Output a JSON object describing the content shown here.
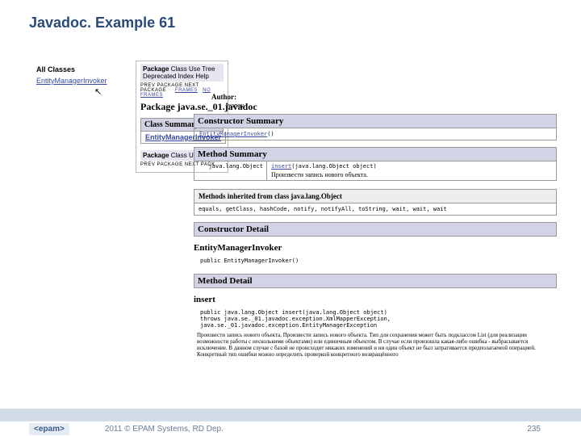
{
  "slide": {
    "title": "Javadoc. Example 61"
  },
  "left": {
    "all_classes": "All Classes",
    "class_link": "EntityManagerInvoker"
  },
  "nav": {
    "items": [
      "Package",
      "Class",
      "Use",
      "Tree",
      "Deprecated",
      "Index",
      "Help"
    ],
    "prev_next": "PREV PACKAGE  NEXT PACKAGE",
    "frames": "FRAMES",
    "no_frames": "NO FRAMES",
    "nav2_items": [
      "Package",
      "Class",
      "Use"
    ],
    "prev_next2": "PREV PACKAGE  NEXT PACK"
  },
  "package": {
    "heading": "Package java.se._01.javadoc"
  },
  "class_summary": {
    "heading": "Class Summary",
    "link": "EntityManagerInvoker"
  },
  "author": {
    "label": "Author:",
    "value": "Ivanov"
  },
  "constructor_summary": {
    "heading": "Constructor Summary",
    "link": "EntityManagerInvoker",
    "link_tail": "()"
  },
  "method_summary": {
    "heading": "Method Summary",
    "return_type": "java.lang.Object",
    "method_link": "insert",
    "method_tail": "(java.lang.Object object)",
    "method_desc": "Произвести запись нового объекта."
  },
  "inherited": {
    "heading": "Methods inherited from class java.lang.Object",
    "body": "equals, getClass, hashCode, notify, notifyAll, toString, wait, wait, wait"
  },
  "constructor_detail": {
    "heading": "Constructor Detail",
    "name": "EntityManagerInvoker",
    "sig": "public EntityManagerInvoker()"
  },
  "method_detail": {
    "heading": "Method Detail",
    "name": "insert",
    "sig_line1": "public java.lang.Object insert(java.lang.Object object)",
    "sig_line2": "                     throws java.se._01.javadoc.exception.XmlMapperException,",
    "sig_line3": "                            java.se._01.javadoc.exception.EntityManagerException",
    "desc": "Произвести запись нового объекта. Произвести запись нового объекта. Тип для сохранения может быть подклассом List (для реализации возможности работы с несколькими объектами) или единичным объектом. В случае если произошла какая-либо ошибка - выбрасывается исключение. В данном случае с базой не происходит никаких изменений и ни один объект не был затрагивается предполагаемой операцией. Конкретный тип ошибки можно определить проверкой конкретного возвращённого"
  },
  "footer": {
    "brand": "<epam>",
    "copyright": "2011 © EPAM Systems, RD Dep.",
    "page": "235"
  }
}
